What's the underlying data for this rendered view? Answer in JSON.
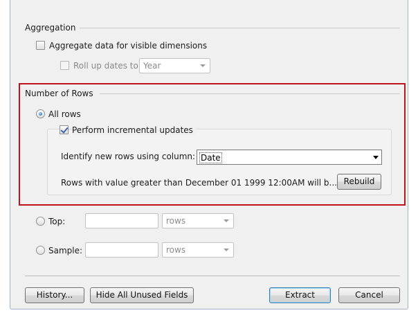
{
  "aggregation": {
    "title": "Aggregation",
    "aggregate_visible_label": "Aggregate data for visible dimensions",
    "rollup_label": "Roll up dates to",
    "rollup_value": "Year"
  },
  "rows": {
    "title": "Number of Rows",
    "all_rows_label": "All rows",
    "incremental_label": "Perform incremental updates",
    "identify_label": "Identify new rows using column:",
    "identify_value": "Date",
    "status_text": "Rows with value greater than December 01 1999 12:00AM will b...",
    "rebuild_label": "Rebuild",
    "top_label": "Top:",
    "top_unit": "rows",
    "sample_label": "Sample:",
    "sample_unit": "rows"
  },
  "footer": {
    "history_label": "History...",
    "hide_unused_label": "Hide All Unused Fields",
    "extract_label": "Extract",
    "cancel_label": "Cancel"
  },
  "colors": {
    "highlight_border": "#c0121a",
    "radio_selected": "#1f5fc0"
  }
}
